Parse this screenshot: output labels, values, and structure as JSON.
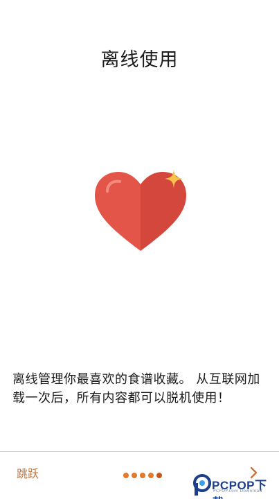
{
  "page": {
    "title": "离线使用",
    "description": "离线管理你最喜欢的食谱收藏。 从互联网加载一次后，所有内容都可以脱机使用！"
  },
  "footer": {
    "skip_label": "跳跃",
    "page_indicator": {
      "total": 5,
      "current": 5
    },
    "next_icon": "chevron-right-icon"
  },
  "illustration": {
    "icon": "heart-icon",
    "sparkle_icon": "sparkle-icon",
    "heart_color": "#e25548",
    "heart_shade_color": "#d4473c",
    "sparkle_color": "#f5c24a"
  },
  "watermark": {
    "brand": "PCPOP下载",
    "subtitle": "PCPOP.com Download"
  },
  "colors": {
    "accent": "#c8743c",
    "dot": "#e07a2c",
    "divider": "#d9cfc4"
  }
}
